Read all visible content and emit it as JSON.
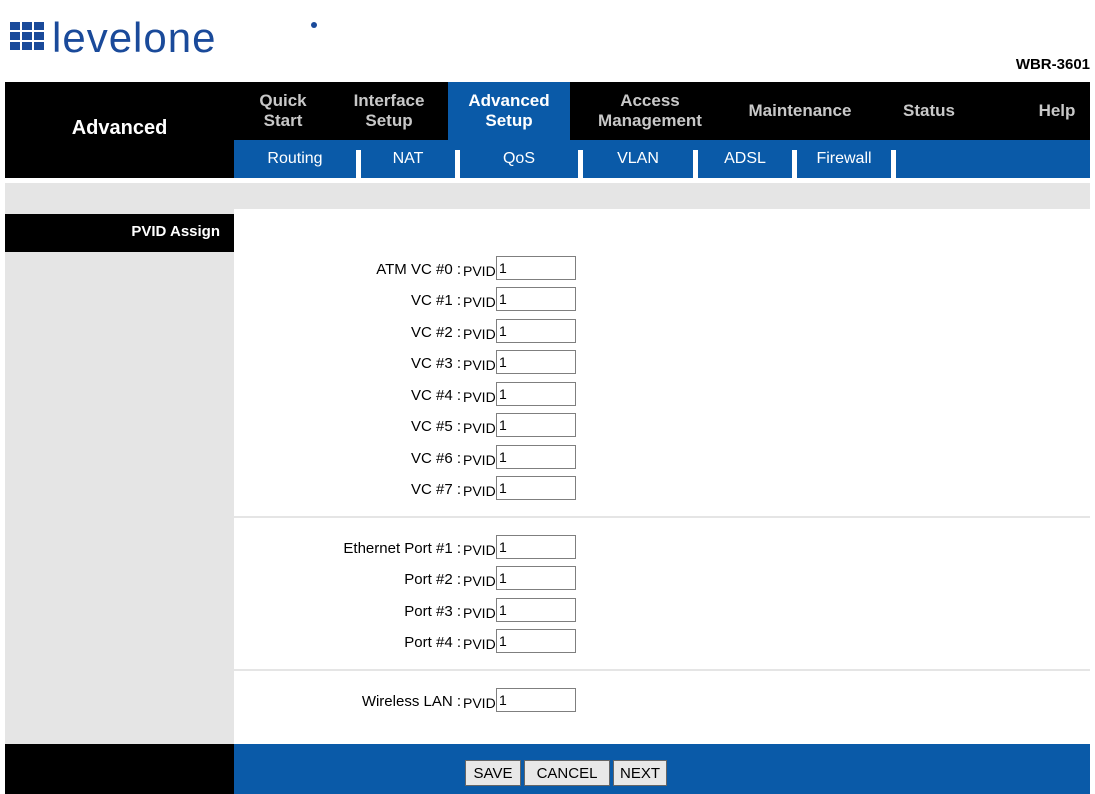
{
  "brand": {
    "logo_text": "levelone",
    "model": "WBR-3601",
    "logo_color": "#1a4a9a"
  },
  "section_title": "Advanced",
  "nav": {
    "items": [
      {
        "line1": "Quick",
        "line2": "Start"
      },
      {
        "line1": "Interface",
        "line2": "Setup"
      },
      {
        "line1": "Advanced",
        "line2": "Setup",
        "active": true
      },
      {
        "line1": "Access",
        "line2": "Management"
      },
      {
        "line1": "Maintenance",
        "line2": ""
      },
      {
        "line1": "Status",
        "line2": ""
      },
      {
        "line1": "Help",
        "line2": ""
      }
    ],
    "sub_items": [
      "Routing",
      "NAT",
      "QoS",
      "VLAN",
      "ADSL",
      "Firewall"
    ]
  },
  "sidebar": {
    "label": "PVID Assign"
  },
  "pvid_label": "PVID",
  "atm_rows": [
    {
      "label": "ATM VC #0 :",
      "value": "1"
    },
    {
      "label": "VC #1 :",
      "value": "1"
    },
    {
      "label": "VC #2 :",
      "value": "1"
    },
    {
      "label": "VC #3 :",
      "value": "1"
    },
    {
      "label": "VC #4 :",
      "value": "1"
    },
    {
      "label": "VC #5 :",
      "value": "1"
    },
    {
      "label": "VC #6 :",
      "value": "1"
    },
    {
      "label": "VC #7 :",
      "value": "1"
    }
  ],
  "eth_rows": [
    {
      "label": "Ethernet Port #1 :",
      "value": "1"
    },
    {
      "label": "Port #2 :",
      "value": "1"
    },
    {
      "label": "Port #3 :",
      "value": "1"
    },
    {
      "label": "Port #4 :",
      "value": "1"
    }
  ],
  "wlan_rows": [
    {
      "label": "Wireless LAN :",
      "value": "1"
    }
  ],
  "buttons": {
    "save": "SAVE",
    "cancel": "CANCEL",
    "next": "NEXT"
  },
  "colors": {
    "nav_blue": "#0a5aa8",
    "black": "#000000",
    "gray": "#e5e5e5"
  }
}
